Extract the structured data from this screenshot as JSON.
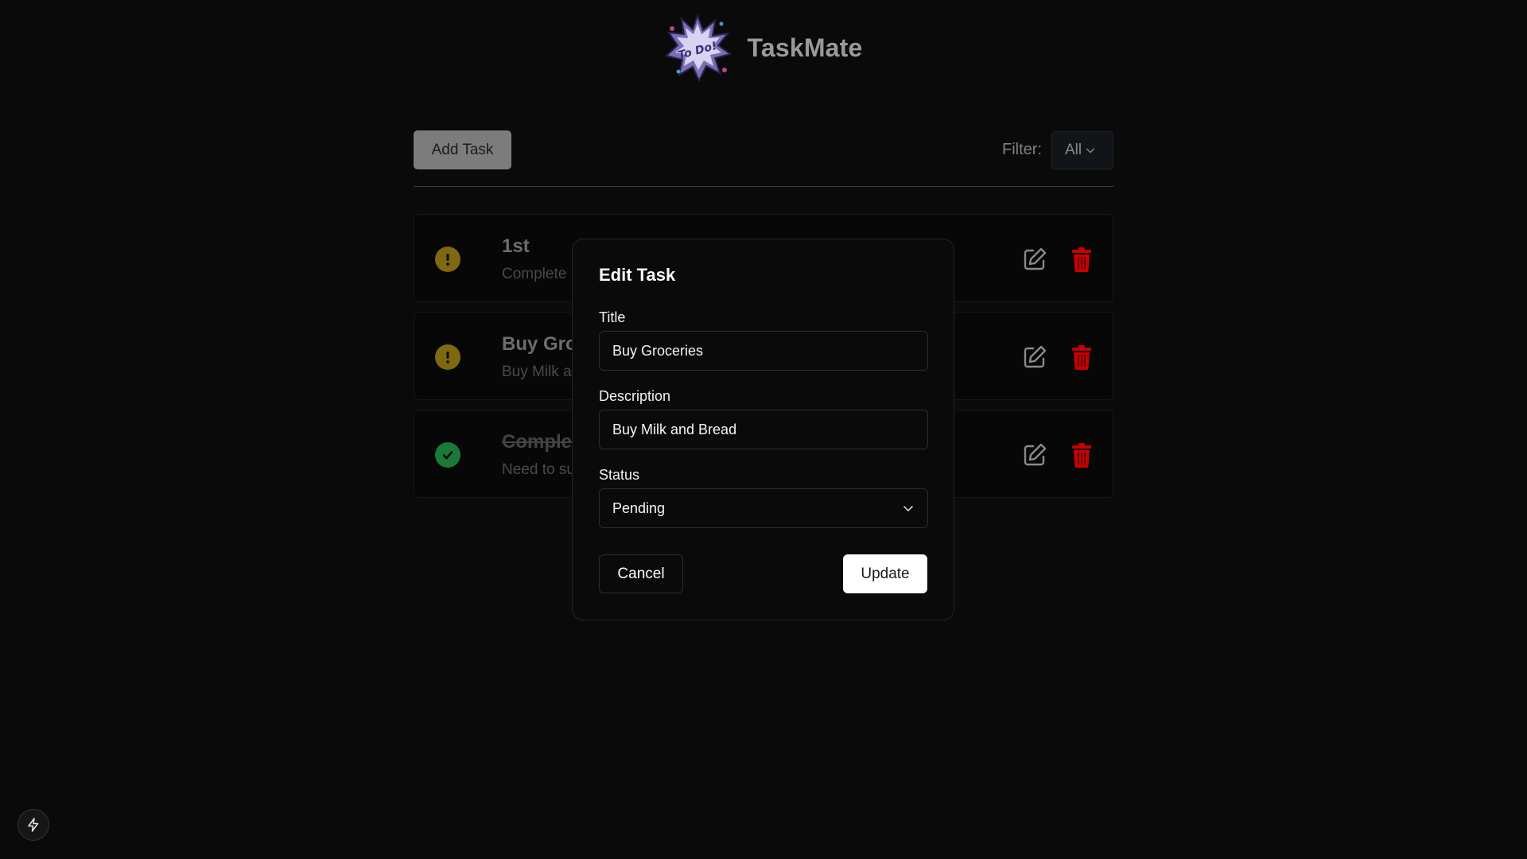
{
  "app": {
    "title": "TaskMate",
    "logo_text": "To Do!"
  },
  "toolbar": {
    "add_task_label": "Add Task",
    "filter_label": "Filter:",
    "filter_value": "All"
  },
  "tasks": [
    {
      "title": "1st",
      "description": "Complete",
      "status": "pending"
    },
    {
      "title": "Buy Gro",
      "description": "Buy Milk a",
      "status": "pending"
    },
    {
      "title": "Comple",
      "description": "Need to su",
      "status": "completed"
    }
  ],
  "modal": {
    "title": "Edit Task",
    "title_label": "Title",
    "title_value": "Buy Groceries",
    "description_label": "Description",
    "description_value": "Buy Milk and Bread",
    "status_label": "Status",
    "status_value": "Pending",
    "cancel_label": "Cancel",
    "update_label": "Update"
  },
  "icons": {
    "pending": "exclamation-icon",
    "completed": "check-icon",
    "edit": "edit-icon",
    "delete": "trash-icon",
    "corner": "lightning-icon"
  },
  "colors": {
    "pending": "#7e6811",
    "completed": "#1b7a3a",
    "delete": "#c80000",
    "primary_button": "#ffffff"
  }
}
